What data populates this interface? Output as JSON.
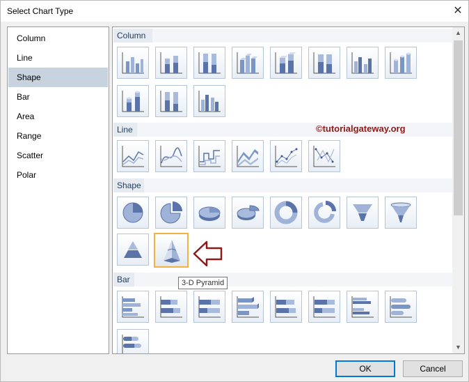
{
  "dialog": {
    "title": "Select Chart Type"
  },
  "categories": [
    "Column",
    "Line",
    "Shape",
    "Bar",
    "Area",
    "Range",
    "Scatter",
    "Polar"
  ],
  "selected_category": "Shape",
  "sections": {
    "column": {
      "label": "Column"
    },
    "line": {
      "label": "Line"
    },
    "shape": {
      "label": "Shape"
    },
    "bar": {
      "label": "Bar"
    }
  },
  "thumbnails": {
    "column": [
      "column-chart",
      "stacked-column-chart",
      "100-stacked-column-chart",
      "3d-column-chart",
      "3d-stacked-column-chart",
      "3d-100-stacked-column-chart",
      "3d-clustered-column-chart",
      "3d-cylinder-chart",
      "3d-stacked-cylinder-chart",
      "3d-100-stacked-cylinder-chart",
      "3d-clustered-cylinder-chart"
    ],
    "line": [
      "line-chart",
      "smooth-line-chart",
      "stepped-line-chart",
      "3d-line-chart",
      "line-with-markers-chart",
      "scatter-with-lines-chart"
    ],
    "shape": [
      "pie-chart",
      "exploded-pie-chart",
      "3d-pie-chart",
      "3d-exploded-pie-chart",
      "doughnut-chart",
      "exploded-doughnut-chart",
      "funnel-chart",
      "3d-funnel-chart",
      "pyramid-chart",
      "3d-pyramid-chart"
    ],
    "bar": [
      "bar-chart",
      "stacked-bar-chart",
      "100-stacked-bar-chart",
      "3d-bar-chart",
      "3d-stacked-bar-chart",
      "3d-100-stacked-bar-chart",
      "3d-clustered-bar-chart",
      "3d-cylinder-bar-chart",
      "3d-stacked-cylinder-bar-chart"
    ]
  },
  "selected_thumbnail": "3d-pyramid-chart",
  "tooltip": "3-D Pyramid",
  "watermark": "©tutorialgateway.org",
  "buttons": {
    "ok": "OK",
    "cancel": "Cancel"
  },
  "colors": {
    "selection": "#c7d3df",
    "highlight": "#f4b13d",
    "accent": "#0078d7",
    "watermark": "#8b1a1a",
    "arrow": "#8b1a1a"
  }
}
